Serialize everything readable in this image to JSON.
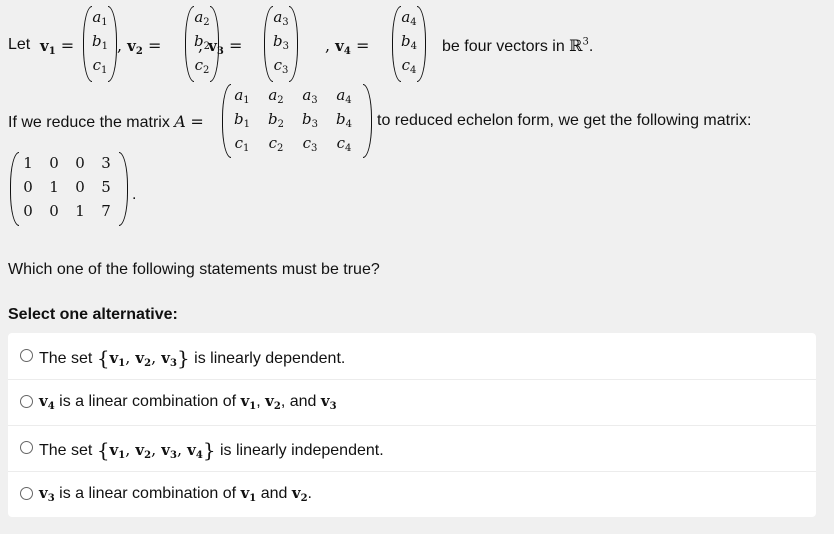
{
  "intro": {
    "let": "Let",
    "eq": "=",
    "comma": ",",
    "suffix": "be four vectors in",
    "space_symbol": "ℝ",
    "space_exp": "3",
    "period": "."
  },
  "vectors": [
    {
      "name": "v",
      "sub": "1",
      "entries": [
        {
          "v": "a",
          "s": "1"
        },
        {
          "v": "b",
          "s": "1"
        },
        {
          "v": "c",
          "s": "1"
        }
      ]
    },
    {
      "name": "v",
      "sub": "2",
      "entries": [
        {
          "v": "a",
          "s": "2"
        },
        {
          "v": "b",
          "s": "2"
        },
        {
          "v": "c",
          "s": "2"
        }
      ]
    },
    {
      "name": "v",
      "sub": "3",
      "entries": [
        {
          "v": "a",
          "s": "3"
        },
        {
          "v": "b",
          "s": "3"
        },
        {
          "v": "c",
          "s": "3"
        }
      ]
    },
    {
      "name": "v",
      "sub": "4",
      "entries": [
        {
          "v": "a",
          "s": "4"
        },
        {
          "v": "b",
          "s": "4"
        },
        {
          "v": "c",
          "s": "4"
        }
      ]
    }
  ],
  "reduce_sentence": {
    "prefix": "If we reduce the matrix",
    "matrix_name": "A",
    "eq": "=",
    "suffix": "to reduced echelon form, we get the following matrix:"
  },
  "matrix_A": [
    [
      {
        "v": "a",
        "s": "1"
      },
      {
        "v": "a",
        "s": "2"
      },
      {
        "v": "a",
        "s": "3"
      },
      {
        "v": "a",
        "s": "4"
      }
    ],
    [
      {
        "v": "b",
        "s": "1"
      },
      {
        "v": "b",
        "s": "2"
      },
      {
        "v": "b",
        "s": "3"
      },
      {
        "v": "b",
        "s": "4"
      }
    ],
    [
      {
        "v": "c",
        "s": "1"
      },
      {
        "v": "c",
        "s": "2"
      },
      {
        "v": "c",
        "s": "3"
      },
      {
        "v": "c",
        "s": "4"
      }
    ]
  ],
  "rref": [
    [
      "1",
      "0",
      "0",
      "3"
    ],
    [
      "0",
      "1",
      "0",
      "5"
    ],
    [
      "0",
      "0",
      "1",
      "7"
    ]
  ],
  "rref_period": ".",
  "question": "Which one of the following statements must be true?",
  "select_label": "Select one alternative:",
  "options": [
    {
      "pre": "The set",
      "set": [
        "1",
        "2",
        "3"
      ],
      "post": "is linearly dependent."
    },
    {
      "lead_sub": "4",
      "mid": "is a linear combination of",
      "list": [
        "1",
        "2"
      ],
      "and": "and",
      "last_sub": "3",
      "end": ""
    },
    {
      "pre": "The set",
      "set": [
        "1",
        "2",
        "3",
        "4"
      ],
      "post": "is linearly independent."
    },
    {
      "lead_sub": "3",
      "mid": "is a linear combination of",
      "list": [
        "1"
      ],
      "and": "and",
      "last_sub": "2",
      "end": "."
    }
  ],
  "symbols": {
    "vec": "v",
    "comma": ",",
    "open_brace": "{",
    "close_brace": "}"
  }
}
